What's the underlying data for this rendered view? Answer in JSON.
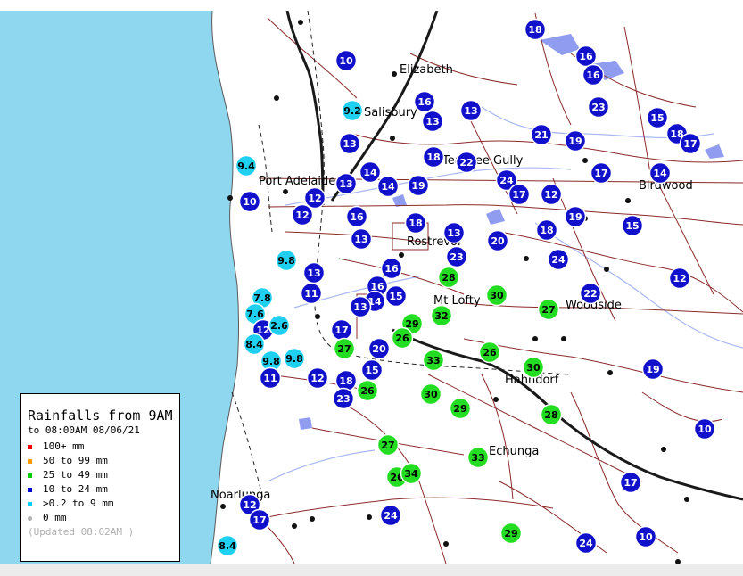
{
  "legend": {
    "title": "Rainfalls from 9AM",
    "subtitle": "to 08:00AM 08/06/21",
    "items": [
      {
        "label": "100+ mm",
        "color": "#ff0000"
      },
      {
        "label": "50  to 99 mm",
        "color": "#ff9900"
      },
      {
        "label": "25  to 49 mm",
        "color": "#00cc00"
      },
      {
        "label": "10  to 24 mm",
        "color": "#0000cc"
      },
      {
        "label": ">0.2 to 9 mm",
        "color": "#00ccff"
      },
      {
        "label": "0 mm",
        "color": "#b0b0b0"
      }
    ],
    "updated": "(Updated 08:02AM  )"
  },
  "towns": [
    "Elizabeth",
    "Salisbury",
    "Port Adelaide",
    "Tea Tree Gully",
    "Birdwood",
    "Rostrevor",
    "Mt Lofty",
    "Woodside",
    "Hahndorf",
    "Echunga",
    "Noarlunga"
  ],
  "gauges": [
    "18",
    "10",
    "16",
    "16",
    "9.2",
    "16",
    "13",
    "13",
    "23",
    "15",
    "18",
    "17",
    "13",
    "21",
    "19",
    "9.4",
    "18",
    "22",
    "14",
    "17",
    "14",
    "13",
    "12",
    "14",
    "24",
    "17",
    "19",
    "10",
    "12",
    "16",
    "12",
    "18",
    "19",
    "13",
    "18",
    "15",
    "9.8",
    "13",
    "20",
    "13",
    "23",
    "24",
    "16",
    "28",
    "12",
    "11",
    "16",
    "15",
    "30",
    "22",
    "7.8",
    "14",
    "32",
    "27",
    "7.6",
    "13",
    "12",
    "2.6",
    "29",
    "17",
    "26",
    "8.4",
    "27",
    "20",
    "26",
    "33",
    "30",
    "9.8",
    "9.8",
    "15",
    "19",
    "11",
    "12",
    "18",
    "26",
    "23",
    "30",
    "29",
    "28",
    "10",
    "27",
    "26",
    "34",
    "33",
    "12",
    "17",
    "17",
    "24",
    "29",
    "8.4",
    "10",
    "24"
  ]
}
